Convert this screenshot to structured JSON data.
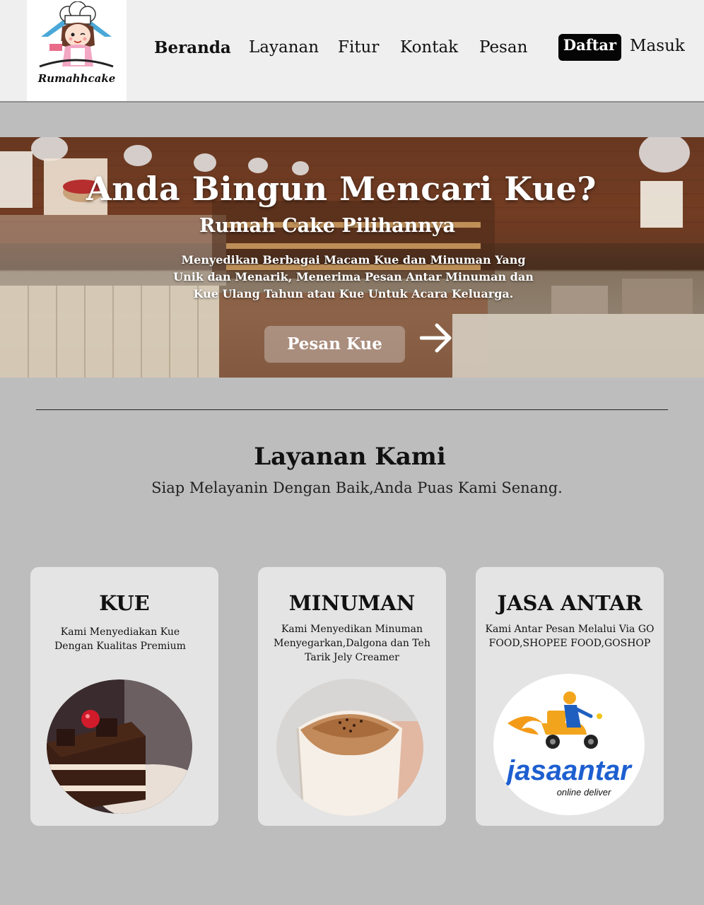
{
  "header": {
    "logo_text": "Rumahhcake",
    "nav": [
      {
        "label": "Beranda"
      },
      {
        "label": "Layanan"
      },
      {
        "label": "Fitur"
      },
      {
        "label": "Kontak"
      },
      {
        "label": "Pesan"
      }
    ],
    "register_label": "Daftar",
    "login_label": "Masuk"
  },
  "hero": {
    "title": "Anda Bingun Mencari Kue?",
    "subtitle": "Rumah Cake Pilihannya",
    "description": "Menyedikan Berbagai Macam Kue dan Minuman Yang Unik dan Menarik, Menerima Pesan Antar Minuman dan Kue Ulang Tahun atau Kue Untuk Acara Keluarga.",
    "cta_label": "Pesan Kue"
  },
  "services": {
    "title": "Layanan Kami",
    "subtitle": "Siap Melayanin Dengan Baik,Anda Puas Kami Senang.",
    "cards": [
      {
        "title": "KUE",
        "description": "Kami Menyediakan Kue Dengan Kualitas Premium",
        "icon": "cake-image"
      },
      {
        "title": "MINUMAN",
        "description": "Kami Menyedikan Minuman Menyegarkan,Dalgona dan Teh Tarik Jely Creamer",
        "icon": "drink-image"
      },
      {
        "title": "JASA ANTAR",
        "description": "Kami Antar Pesan Melalui Via GO FOOD,SHOPEE FOOD,GOSHOP",
        "icon": "delivery-logo",
        "logo_text": "jasaantar",
        "logo_tagline": "online deliver"
      }
    ]
  },
  "colors": {
    "page_bg": "#bdbdbd",
    "header_bg": "#efefef",
    "card_bg": "#e4e4e4",
    "button_dark": "#050505"
  }
}
